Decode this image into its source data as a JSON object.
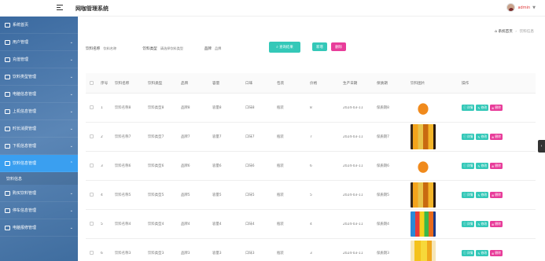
{
  "app": {
    "title": "网咖管理系统"
  },
  "user": {
    "name": "admin"
  },
  "sidebar": {
    "items": [
      {
        "label": "系统首页"
      },
      {
        "label": "用户管理"
      },
      {
        "label": "充值管理"
      },
      {
        "label": "饮料类型管理"
      },
      {
        "label": "电脑信息管理"
      },
      {
        "label": "上机信息管理"
      },
      {
        "label": "时长消费管理"
      },
      {
        "label": "下机信息管理"
      },
      {
        "label": "饮料信息管理"
      },
      {
        "label": "购买饮料管理"
      },
      {
        "label": "停车信息管理"
      },
      {
        "label": "电脑报修管理"
      }
    ],
    "submenu": {
      "label": "饮料信息"
    }
  },
  "breadcrumb": {
    "home": "系统首页",
    "current": "饮料信息"
  },
  "search": {
    "name_label": "饮料名称",
    "name_placeholder": "饮料名称",
    "type_label": "饮料类型",
    "type_placeholder": "请选择饮料类型",
    "brand_label": "品牌",
    "brand_placeholder": "品牌",
    "search_button": "查询结果",
    "add_button": "新增",
    "delete_button": "删除"
  },
  "table": {
    "headers": [
      "序号",
      "饮料名称",
      "饮料类型",
      "品牌",
      "容量",
      "口味",
      "包装",
      "价格",
      "生产日期",
      "保质期",
      "饮料图片",
      "操作"
    ],
    "rows": [
      {
        "seq": "1",
        "name": "饮料名称8",
        "type": "饮料类型8",
        "brand": "品牌8",
        "cap": "容量8",
        "taste": "口味8",
        "pack": "瓶装",
        "price": "8",
        "date": "2024-03-11",
        "shelf": "保质期8",
        "img": "orange-bottle"
      },
      {
        "seq": "2",
        "name": "饮料名称7",
        "type": "饮料类型7",
        "brand": "品牌7",
        "cap": "容量7",
        "taste": "口味7",
        "pack": "瓶装",
        "price": "7",
        "date": "2024-03-11",
        "shelf": "保质期7",
        "img": "juice-glasses"
      },
      {
        "seq": "3",
        "name": "饮料名称6",
        "type": "饮料类型6",
        "brand": "品牌6",
        "cap": "容量6",
        "taste": "口味6",
        "pack": "瓶装",
        "price": "6",
        "date": "2024-03-11",
        "shelf": "保质期6",
        "img": "orange-bottle"
      },
      {
        "seq": "4",
        "name": "饮料名称5",
        "type": "饮料类型5",
        "brand": "品牌5",
        "cap": "容量5",
        "taste": "口味5",
        "pack": "瓶装",
        "price": "5",
        "date": "2024-03-11",
        "shelf": "保质期5",
        "img": "juice-glasses"
      },
      {
        "seq": "5",
        "name": "饮料名称4",
        "type": "饮料类型4",
        "brand": "品牌4",
        "cap": "容量4",
        "taste": "口味4",
        "pack": "瓶装",
        "price": "4",
        "date": "2024-03-11",
        "shelf": "保质期4",
        "img": "soda-bottles"
      },
      {
        "seq": "6",
        "name": "饮料名称3",
        "type": "饮料类型3",
        "brand": "品牌3",
        "cap": "容量3",
        "taste": "口味3",
        "pack": "瓶装",
        "price": "3",
        "date": "2024-03-11",
        "shelf": "保质期3",
        "img": "yellow-drinks"
      }
    ],
    "ops": {
      "detail": "详情",
      "edit": "修改",
      "delete": "删除"
    }
  },
  "colors": {
    "accent": "#34c8b8",
    "danger": "#e83d9a",
    "sidebar": "#4a78ab",
    "active": "#3a9ff0"
  }
}
